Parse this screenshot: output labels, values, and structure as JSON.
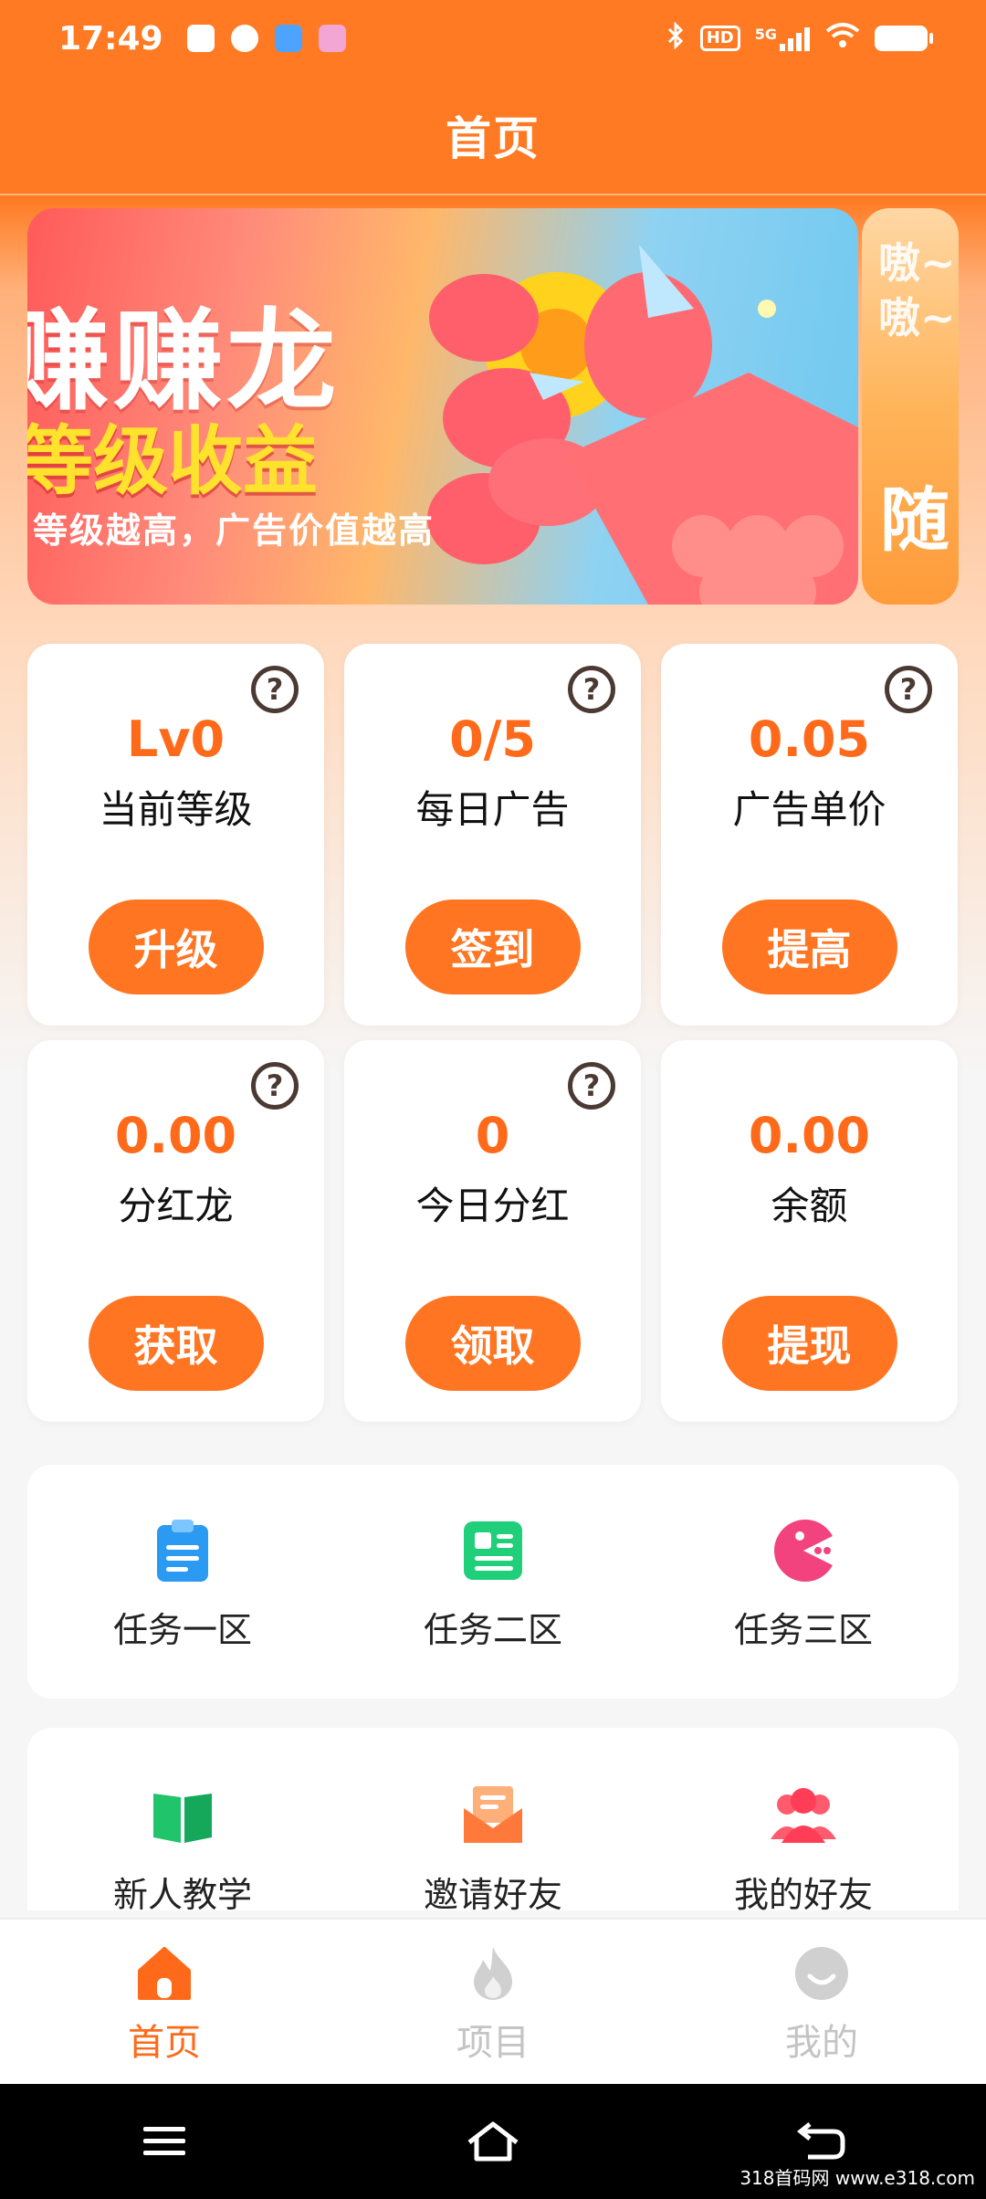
{
  "status_bar": {
    "time": "17:49",
    "hd": "HD",
    "network": "5G"
  },
  "header": {
    "title": "首页"
  },
  "banner": {
    "title": "赚赚龙",
    "subtitle": "等级收益",
    "caption": "等级越高，广告价值越高",
    "peek_text_1": "嗷~ 嗷~",
    "peek_text_2": "随"
  },
  "stats": [
    {
      "value": "Lv0",
      "label": "当前等级",
      "action": "升级",
      "has_help": true
    },
    {
      "value": "0/5",
      "label": "每日广告",
      "action": "签到",
      "has_help": true
    },
    {
      "value": "0.05",
      "label": "广告单价",
      "action": "提高",
      "has_help": true
    },
    {
      "value": "0.00",
      "label": "分红龙",
      "action": "获取",
      "has_help": true
    },
    {
      "value": "0",
      "label": "今日分红",
      "action": "领取",
      "has_help": true
    },
    {
      "value": "0.00",
      "label": "余额",
      "action": "提现",
      "has_help": false
    }
  ],
  "task_menu": [
    {
      "label": "任务一区",
      "icon": "clipboard-icon"
    },
    {
      "label": "任务二区",
      "icon": "document-list-icon"
    },
    {
      "label": "任务三区",
      "icon": "pacman-icon"
    }
  ],
  "social_menu": [
    {
      "label": "新人教学",
      "icon": "open-book-icon"
    },
    {
      "label": "邀请好友",
      "icon": "envelope-icon"
    },
    {
      "label": "我的好友",
      "icon": "users-icon"
    }
  ],
  "bottom_nav": [
    {
      "label": "首页",
      "icon": "home-icon",
      "active": true
    },
    {
      "label": "项目",
      "icon": "flame-icon",
      "active": false
    },
    {
      "label": "我的",
      "icon": "smiley-icon",
      "active": false
    }
  ],
  "watermark": "318首码网 www.e318.com",
  "colors": {
    "primary": "#ff7521",
    "value_text": "#ff6a1a",
    "header_bg": "#ff7a22",
    "inactive_nav": "#c4c4c4"
  }
}
